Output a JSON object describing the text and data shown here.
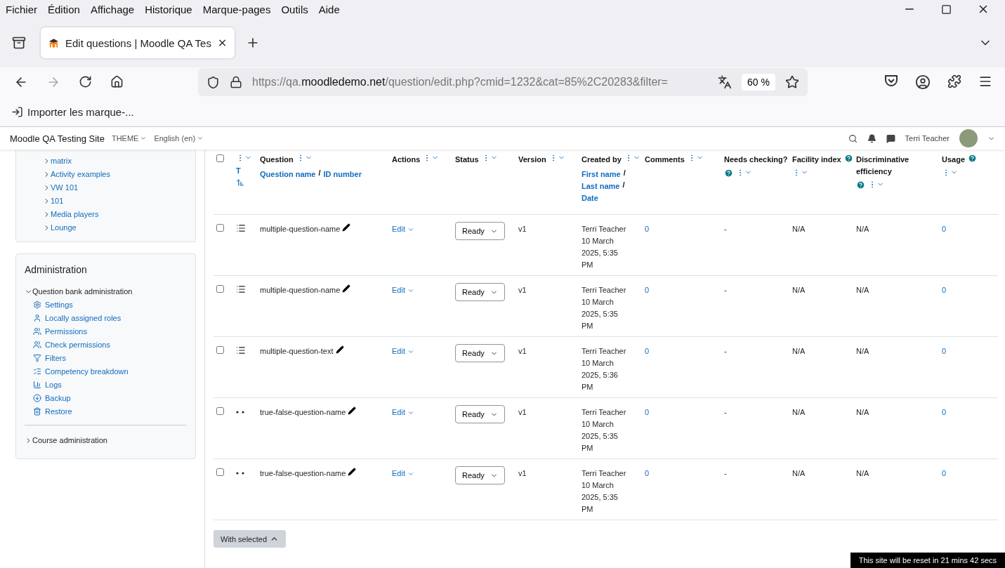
{
  "menu_bar": {
    "items": [
      "Fichier",
      "Édition",
      "Affichage",
      "Historique",
      "Marque-pages",
      "Outils",
      "Aide"
    ]
  },
  "tabs": [
    {
      "title": "Edit questions | Moodle QA Tes",
      "selected": true
    }
  ],
  "address_bar": {
    "url_start": "https://qa.",
    "url_host": "moodledemo.net",
    "url_rest": "/question/edit.php?cmid=1232&cat=85%2C20283&filter=",
    "zoom": "60 %"
  },
  "bookmarks_bar": {
    "items": [
      "Importer les marque-..."
    ]
  },
  "site_header": {
    "site_name": "Moodle QA Testing Site",
    "theme": "THEME",
    "language": "English (en)",
    "user": "Terri Teacher"
  },
  "category_tree": {
    "items": [
      {
        "label": "matrix",
        "expanded": false
      },
      {
        "label": "Activity examples",
        "expanded": false
      },
      {
        "label": "VW 101",
        "expanded": false
      },
      {
        "label": "101",
        "expanded": false
      },
      {
        "label": "Media players",
        "expanded": false
      },
      {
        "label": "Lounge",
        "expanded": false
      }
    ]
  },
  "administration": {
    "title": "Administration",
    "sections": [
      {
        "label": "Question bank administration",
        "expanded": true,
        "children": [
          "Settings",
          "Locally assigned roles",
          "Permissions",
          "Check permissions",
          "Filters",
          "Competency breakdown",
          "Logs",
          "Backup",
          "Restore"
        ]
      },
      {
        "label": "Course administration",
        "expanded": false
      }
    ]
  },
  "table": {
    "select_all": {
      "checked": false
    },
    "columns": [
      {
        "label": "T",
        "help": false
      },
      {
        "label": "Question",
        "help": false,
        "links": [
          {
            "text": "Question name",
            "separator": "/"
          },
          {
            "text": "ID number"
          }
        ]
      },
      {
        "label": "Actions",
        "help": false
      },
      {
        "label": "Status",
        "help": false
      },
      {
        "label": "Version",
        "help": false
      },
      {
        "label": "Created by",
        "help": false,
        "links": [
          {
            "text": "First name",
            "separator": "/"
          },
          {
            "text": "Last name",
            "separator": "/"
          },
          {
            "text": "Date"
          }
        ]
      },
      {
        "label": "Comments",
        "help": false
      },
      {
        "label": "Needs checking?",
        "help": true
      },
      {
        "label": "Facility index",
        "help": true
      },
      {
        "label": "Discriminative efficiency",
        "help": true
      },
      {
        "label": "Usage",
        "help": true
      }
    ],
    "rows": [
      {
        "kind": "multichoice",
        "checked": false,
        "name": "multiple-question-name",
        "action": "Edit",
        "status": "Ready",
        "version": "v1",
        "creator": "Terri Teacher",
        "created": "10 March 2025, 5:35 PM",
        "comments": "0",
        "needs_checking": "-",
        "facility": "N/A",
        "discrimination": "N/A",
        "usage": "0"
      },
      {
        "kind": "multichoice",
        "checked": false,
        "name": "multiple-question-name",
        "action": "Edit",
        "status": "Ready",
        "version": "v1",
        "creator": "Terri Teacher",
        "created": "10 March 2025, 5:35 PM",
        "comments": "0",
        "needs_checking": "-",
        "facility": "N/A",
        "discrimination": "N/A",
        "usage": "0"
      },
      {
        "kind": "multichoice",
        "checked": false,
        "name": "multiple-question-text",
        "action": "Edit",
        "status": "Ready",
        "version": "v1",
        "creator": "Terri Teacher",
        "created": "10 March 2025, 5:36 PM",
        "comments": "0",
        "needs_checking": "-",
        "facility": "N/A",
        "discrimination": "N/A",
        "usage": "0"
      },
      {
        "kind": "truefalse",
        "checked": false,
        "name": "true-false-question-name",
        "action": "Edit",
        "status": "Ready",
        "version": "v1",
        "creator": "Terri Teacher",
        "created": "10 March 2025, 5:35 PM",
        "comments": "0",
        "needs_checking": "-",
        "facility": "N/A",
        "discrimination": "N/A",
        "usage": "0"
      },
      {
        "kind": "truefalse",
        "checked": false,
        "name": "true-false-question-name",
        "action": "Edit",
        "status": "Ready",
        "version": "v1",
        "creator": "Terri Teacher",
        "created": "10 March 2025, 5:35 PM",
        "comments": "0",
        "needs_checking": "-",
        "facility": "N/A",
        "discrimination": "N/A",
        "usage": "0"
      }
    ]
  },
  "bulk_action": {
    "label": "With selected"
  },
  "reset_notice": "This site will be reset in 21 mins 42 secs"
}
